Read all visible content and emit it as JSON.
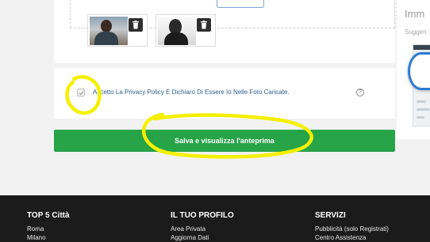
{
  "upload": {
    "photos": [
      {
        "alt": "uploaded photo 1"
      },
      {
        "alt": "uploaded photo 2"
      }
    ]
  },
  "side_panel": {
    "title": "Imm",
    "subtitle": "Suggeri"
  },
  "privacy": {
    "label": "Accetto La Privacy Policy E Dichiaro Di Essere Io Nelle Foto Caricate.",
    "help": "?",
    "checked": true
  },
  "actions": {
    "save_label": "Salva e visualizza l'anteprima"
  },
  "footer": {
    "columns": [
      {
        "heading": "TOP 5 Città",
        "links": [
          "Roma",
          "Milano"
        ]
      },
      {
        "heading": "IL TUO PROFILO",
        "links": [
          "Area Privata",
          "Aggiorna Dati"
        ]
      },
      {
        "heading": "SERVIZI",
        "links": [
          "Pubblicità (solo Registrati)",
          "Centro Assistenza"
        ]
      }
    ]
  },
  "colors": {
    "accent_green": "#27a348",
    "annotation_yellow": "#f4f000",
    "footer_bg": "#1b1b1b",
    "link_blue": "#2e5e8f"
  },
  "icons": {
    "delete": "trash-icon",
    "checkbox": "checkmark-icon",
    "help": "help-circle-icon"
  }
}
